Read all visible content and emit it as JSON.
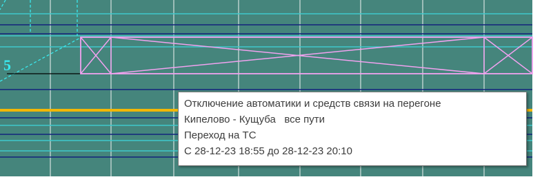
{
  "diagram": {
    "section_number": "5",
    "colors": {
      "background": "#45857c",
      "track_line": "#3ec9cc",
      "navy_line": "#13237d",
      "yellow_track": "#f2b705",
      "grid": "#b9d0cc",
      "closure_box": "#f2a2f0",
      "dashed": "#39e9ef",
      "black_line": "#000000",
      "page_margin": "#ffffff"
    }
  },
  "tooltip": {
    "line1": "Отключение автоматики и средств связи на перегоне",
    "line2": "Кипелово - Кущуба   все пути",
    "line3": "Переход на ТС",
    "line4": "С 28-12-23 18:55 до 28-12-23 20:10"
  }
}
